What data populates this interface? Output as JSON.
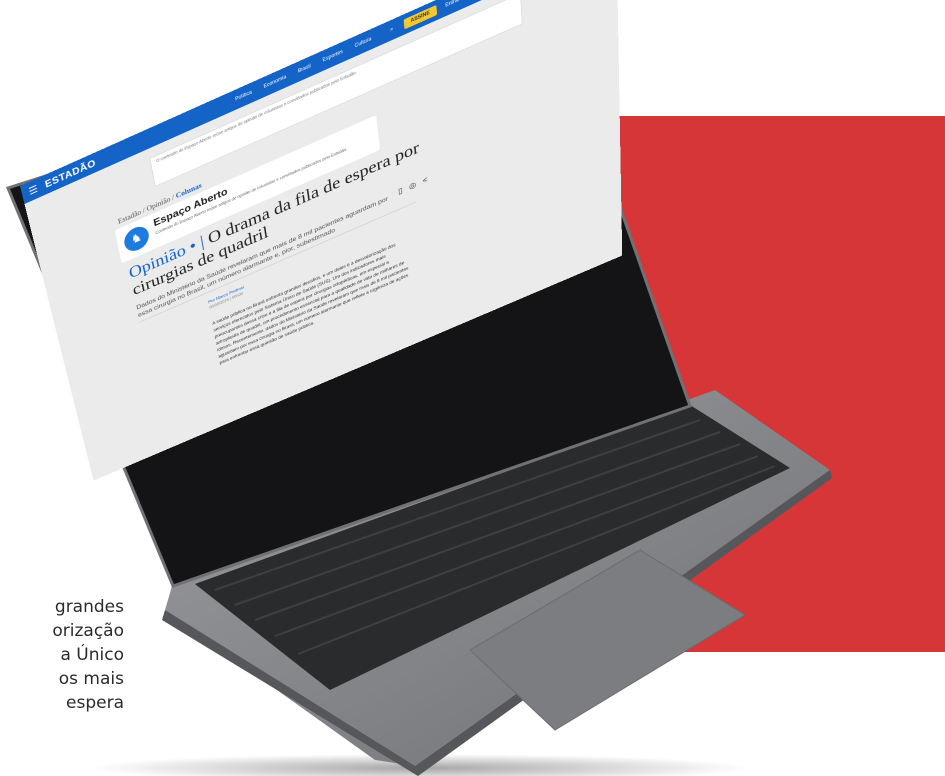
{
  "side_article": {
    "lines": [
      "grandes",
      "orização",
      "a Único",
      "os mais",
      "espera"
    ]
  },
  "browser": {
    "logo": "ESTADÃO",
    "menu_icon": "menu-icon",
    "nav_items": [
      "Política",
      "Economia",
      "Brasil",
      "Esportes",
      "Cultura"
    ],
    "search_icon": "search-icon",
    "subscribe_label": "ASSINE",
    "login_label": "Entrar"
  },
  "ad_banner": {
    "text": "O conteúdo do Espaço Aberto reúne artigos de opinião de colunistas e convidados publicados pelo Estadão."
  },
  "article": {
    "breadcrumb": [
      "Estadão",
      "Opinião"
    ],
    "breadcrumb_current": "Colunas",
    "section_title": "Espaço Aberto",
    "section_subtitle": "Conteúdo do Espaço Aberto reúne artigos de opinião de colunistas e convidados publicados pelo Estadão.",
    "kicker": "Opinião",
    "headline": "O drama da fila de espera por cirurgias de quadril",
    "subhead": "Dados do Ministério da Saúde revelaram que mais de 8 mil pacientes aguardam por essa cirurgia no Brasil, um número alarmante e, pior, subestimado",
    "author_label": "Por Marco Pedrosi",
    "author_date": "00/00/2024 | 00h00",
    "body": "A saúde pública no Brasil enfrenta grandes desafios, e um deles é a desvalorização dos serviços oferecidos pelo Sistema Único de Saúde (SUS). Um dos indicadores mais preocupantes dessa crise é a fila de espera por cirurgias ortopédicas, em especial a artroplastia de quadril, um procedimento essencial para a qualidade de vida de milhares de idosos. Recentemente, dados do Ministério da Saúde revelaram que mais de 8 mil pacientes aguardam por essa cirurgia no Brasil, um número alarmante que reflete a urgência de ações para enfrentar essa questão de saúde pública."
  },
  "colors": {
    "accent_red": "#d63638",
    "brand_blue": "#1464c8",
    "subscribe_yellow": "#f4c92f",
    "laptop_body": "#8a8c8f"
  }
}
